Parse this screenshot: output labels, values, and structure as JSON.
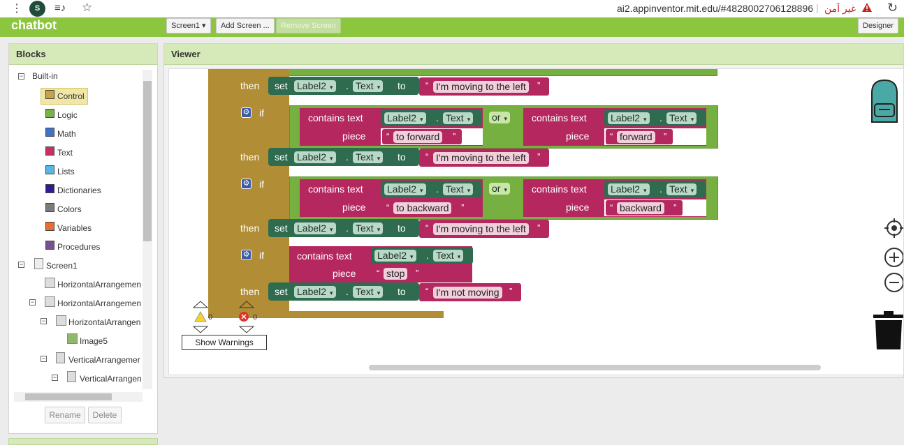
{
  "browser": {
    "avatar_letter": "S",
    "url": "ai2.appinventor.mit.edu/#4828002706128896",
    "security_text": "غير آمن"
  },
  "toolbar": {
    "app_title": "chatbot",
    "screen_select": "Screen1 ▾",
    "add_screen": "Add Screen ...",
    "remove_screen": "Remove Screen",
    "designer": "Designer"
  },
  "blocks_panel": {
    "header": "Blocks",
    "builtin": "Built-in",
    "categories": [
      {
        "label": "Control",
        "color": "#c7a248"
      },
      {
        "label": "Logic",
        "color": "#77b444"
      },
      {
        "label": "Math",
        "color": "#3e73c6"
      },
      {
        "label": "Text",
        "color": "#c33166"
      },
      {
        "label": "Lists",
        "color": "#53b8e6"
      },
      {
        "label": "Dictionaries",
        "color": "#2c1d9b"
      },
      {
        "label": "Colors",
        "color": "#7b7b7b"
      },
      {
        "label": "Variables",
        "color": "#e8702e"
      },
      {
        "label": "Procedures",
        "color": "#7a4f92"
      }
    ],
    "screen": "Screen1",
    "components": [
      "HorizontalArrangemen",
      "HorizontalArrangemen",
      "HorizontalArrangen",
      "Image5",
      "VerticalArrangemer",
      "VerticalArrangen"
    ],
    "rename": "Rename",
    "delete": "Delete"
  },
  "viewer": {
    "header": "Viewer",
    "then": "then",
    "if": "if",
    "set": "set",
    "to": "to",
    "or": "or",
    "contains": "contains text",
    "piece": "piece",
    "component": "Label2",
    "property": "Text",
    "strings": {
      "moving_left": "I'm moving to the left",
      "to_forward": "to forward",
      "forward": "forward",
      "to_backward": "to backward",
      "backward": "backward",
      "stop": "stop",
      "not_moving": "I'm not moving"
    },
    "warnings_count": "0",
    "errors_count": "0",
    "show_warnings": "Show Warnings"
  }
}
